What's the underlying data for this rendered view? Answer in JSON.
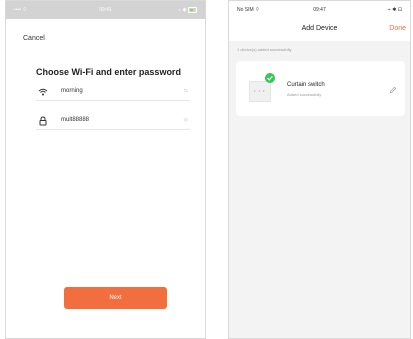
{
  "left_screen": {
    "status_bar": {
      "left": "•••• ⌔",
      "time": "09:41",
      "right": "⌁ ✱"
    },
    "cancel_label": "Cancel",
    "title": "Choose Wi-Fi and enter password",
    "wifi_field": {
      "value": "morning",
      "trail_text": "⇆",
      "icon": "wifi-icon"
    },
    "password_field": {
      "value": "mult88888",
      "trail_text": "◎",
      "icon": "lock-icon"
    },
    "next_label": "Next",
    "accent_color": "#f26e3e"
  },
  "right_screen": {
    "status_bar": {
      "left": "No SIM ⌔",
      "time": "09:47",
      "right": "⌁ ✱ ⊡"
    },
    "nav": {
      "title": "Add Device",
      "done_label": "Done"
    },
    "added_note": "1 device(s) added successfully",
    "device": {
      "name": "Curtain switch",
      "status": "Added successfully",
      "badge_color": "#38c75b",
      "icon": "edit-icon"
    }
  }
}
